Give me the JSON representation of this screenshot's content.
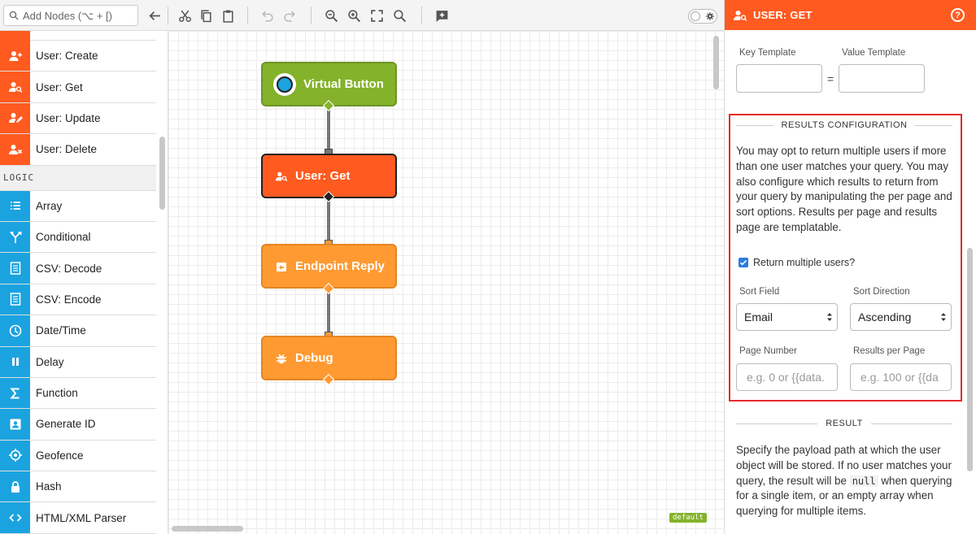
{
  "toolbar": {
    "search_placeholder": "Add Nodes (⌥ + [)",
    "icons": [
      "back-arrow-icon",
      "cut-icon",
      "copy-icon",
      "paste-icon",
      "undo-icon",
      "redo-icon",
      "zoom-out-icon",
      "zoom-in-icon",
      "fit-screen-icon",
      "zoom-reset-icon",
      "add-comment-icon"
    ]
  },
  "sidebar": {
    "items_top": [
      {
        "label": "User: Create",
        "icon": "user-plus-icon"
      },
      {
        "label": "User: Get",
        "icon": "user-search-icon"
      },
      {
        "label": "User: Update",
        "icon": "user-edit-icon"
      },
      {
        "label": "User: Delete",
        "icon": "user-delete-icon"
      }
    ],
    "section_logic": "LOGIC",
    "items_logic": [
      {
        "label": "Array",
        "icon": "list-icon"
      },
      {
        "label": "Conditional",
        "icon": "branch-icon"
      },
      {
        "label": "CSV: Decode",
        "icon": "csv-decode-icon"
      },
      {
        "label": "CSV: Encode",
        "icon": "csv-encode-icon"
      },
      {
        "label": "Date/Time",
        "icon": "clock-icon"
      },
      {
        "label": "Delay",
        "icon": "pause-icon"
      },
      {
        "label": "Function",
        "icon": "sigma-icon"
      },
      {
        "label": "Generate ID",
        "icon": "id-card-icon"
      },
      {
        "label": "Geofence",
        "icon": "crosshair-icon"
      },
      {
        "label": "Hash",
        "icon": "lock-icon"
      },
      {
        "label": "HTML/XML Parser",
        "icon": "code-icon"
      }
    ]
  },
  "canvas": {
    "nodes": [
      {
        "label": "Virtual Button"
      },
      {
        "label": "User: Get"
      },
      {
        "label": "Endpoint Reply"
      },
      {
        "label": "Debug"
      }
    ],
    "badge": "default"
  },
  "panel": {
    "title": "USER: GET",
    "key_template_label": "Key Template",
    "value_template_label": "Value Template",
    "equals": "=",
    "results_config_title": "RESULTS CONFIGURATION",
    "results_config_text": "You may opt to return multiple users if more than one user matches your query. You may also configure which results to return from your query by manipulating the per page and sort options. Results per page and results page are templatable.",
    "return_multiple_label": "Return multiple users?",
    "return_multiple_checked": true,
    "sort_field_label": "Sort Field",
    "sort_field_value": "Email",
    "sort_direction_label": "Sort Direction",
    "sort_direction_value": "Ascending",
    "page_number_label": "Page Number",
    "page_number_placeholder": "e.g. 0 or {{data.",
    "results_per_page_label": "Results per Page",
    "results_per_page_placeholder": "e.g. 100 or {{da",
    "result_title": "RESULT",
    "result_text_1": "Specify the payload path at which the user object will be stored. If no user matches your query, the result will be",
    "result_code": "null",
    "result_text_2": "when querying for a single item, or an empty array when querying for multiple items."
  },
  "colors": {
    "orange": "#ff5a1f",
    "blue": "#1ba3e0",
    "green": "#84b22b",
    "light_orange": "#ff9a32",
    "highlight_red": "#e52b2b"
  }
}
